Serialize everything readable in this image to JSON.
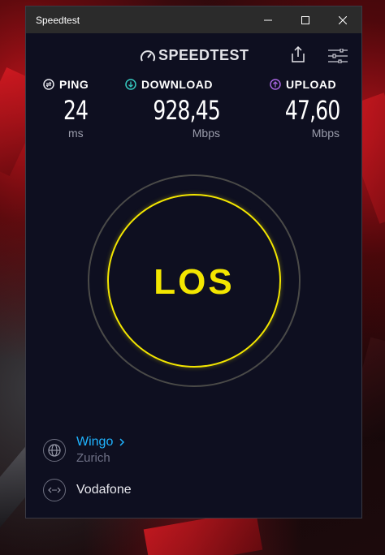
{
  "window": {
    "title": "Speedtest"
  },
  "header": {
    "logo_text": "SPEEDTEST"
  },
  "metrics": {
    "ping": {
      "label": "PING",
      "value": "24",
      "unit": "ms"
    },
    "download": {
      "label": "DOWNLOAD",
      "value": "928,45",
      "unit": "Mbps"
    },
    "upload": {
      "label": "UPLOAD",
      "value": "47,60",
      "unit": "Mbps"
    }
  },
  "gauge": {
    "button_label": "LOS"
  },
  "server": {
    "name": "Wingo",
    "location": "Zurich"
  },
  "isp": {
    "name": "Vodafone"
  },
  "colors": {
    "accent_yellow": "#f3e600",
    "link_blue": "#1fb4ff",
    "background": "#0e0f20",
    "download_icon": "#36c9c0",
    "upload_icon": "#a866e0"
  },
  "icons": [
    "speedometer-logo-icon",
    "share-icon",
    "settings-sliders-icon",
    "ping-icon",
    "download-icon",
    "upload-icon",
    "globe-icon",
    "connection-icon",
    "chevron-right-icon"
  ]
}
